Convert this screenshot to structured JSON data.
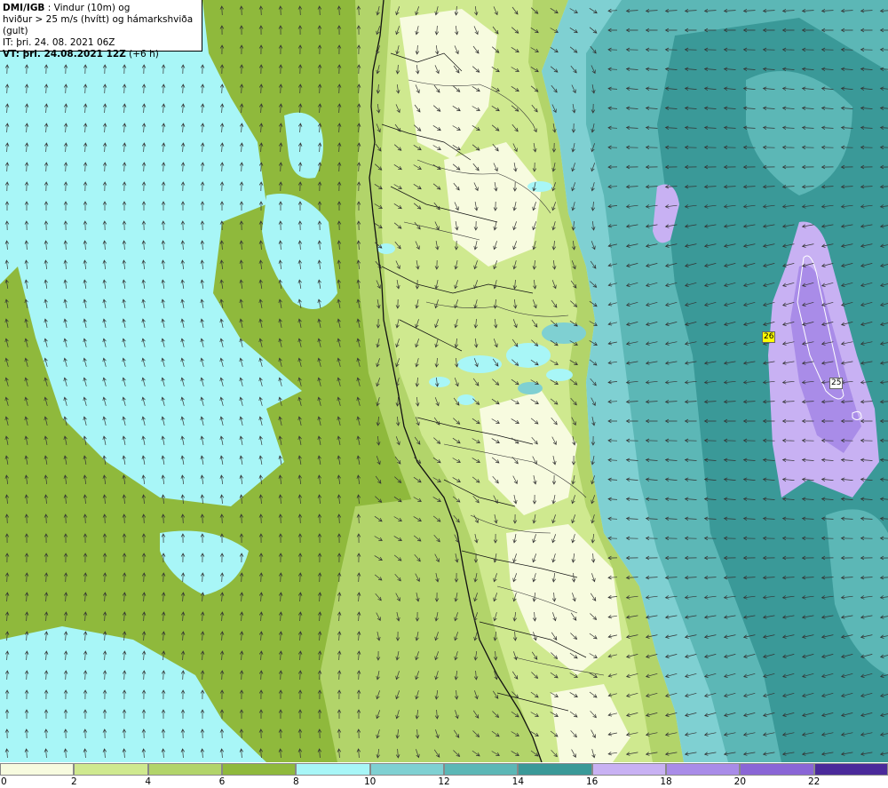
{
  "header": {
    "source": "DMI/IGB",
    "title_rest": " : Vindur (10m) og",
    "line2": "hviður > 25 m/s (hvítt) og hámarkshviða (gult)",
    "issue_time": "IT: þri. 24. 08. 2021 06Z",
    "valid_label": "VT: þri. 24.08.2021 12Z",
    "valid_offset": " (+6 h)"
  },
  "legend": {
    "ticks": [
      "0",
      "2",
      "4",
      "6",
      "8",
      "10",
      "12",
      "14",
      "16",
      "18",
      "20",
      "22"
    ],
    "colors": [
      "#f7fbdf",
      "#cfe98f",
      "#b2d46a",
      "#8fb93c",
      "#a8f6f7",
      "#7fd0d2",
      "#5cb7b6",
      "#3a9998",
      "#c8b1f3",
      "#a98ce8",
      "#8a66d6",
      "#4a2a9a"
    ]
  },
  "map": {
    "gust_labels": [
      {
        "text": "26",
        "style": "yellow"
      },
      {
        "text": "25",
        "style": "white"
      }
    ],
    "colors": {
      "very_light_wind": "#f7fbdf",
      "light_wind": "#cfe98f",
      "moderate_wind": "#b2d46a",
      "fresh_wind": "#8fb93c",
      "cyan_wind": "#a8f6f7",
      "teal_light": "#7fd0d2",
      "teal_mid": "#5cb7b6",
      "teal_dark": "#3a9998",
      "purple_light": "#c8b1f3",
      "purple_mid": "#a98ce8",
      "coast": "#111111",
      "arrow": "#333333"
    }
  }
}
